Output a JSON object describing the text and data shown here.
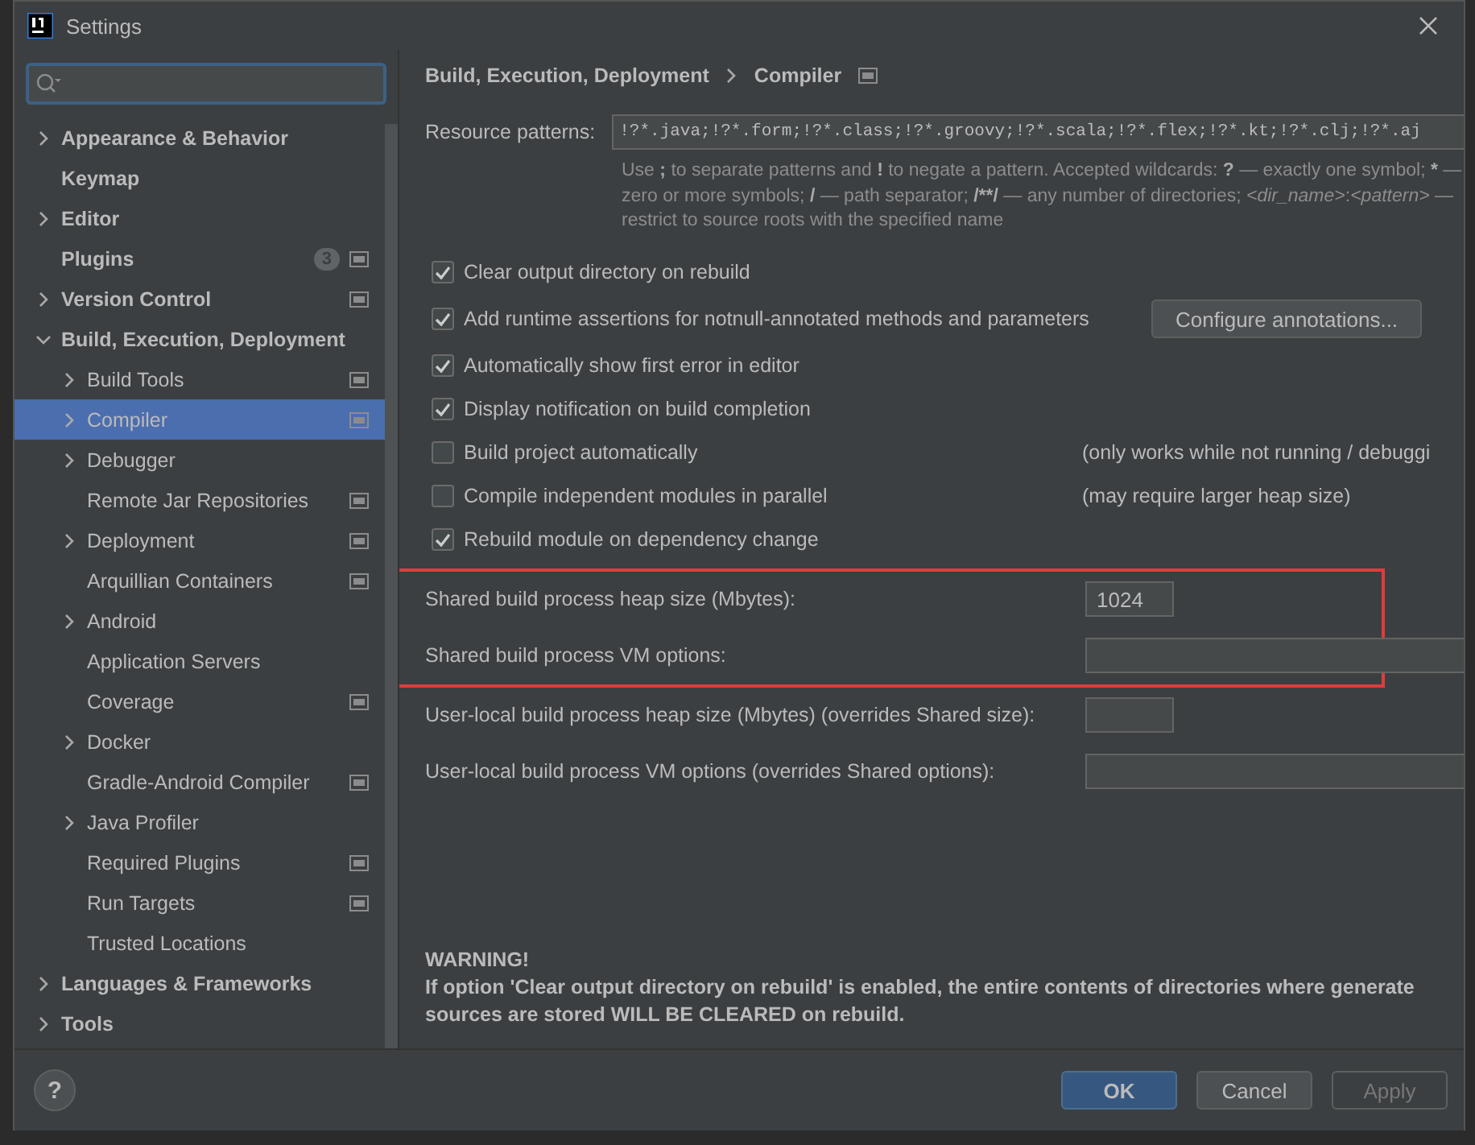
{
  "window": {
    "title": "Settings"
  },
  "sidebar": {
    "items": [
      {
        "label": "Appearance & Behavior",
        "expanded": false,
        "selected": false,
        "project_scope": false
      },
      {
        "label": "Keymap",
        "selected": false,
        "project_scope": false
      },
      {
        "label": "Editor",
        "expanded": false,
        "selected": false,
        "project_scope": false
      },
      {
        "label": "Plugins",
        "selected": false,
        "project_scope": true,
        "badge": "3"
      },
      {
        "label": "Version Control",
        "expanded": false,
        "selected": false,
        "project_scope": true
      },
      {
        "label": "Build, Execution, Deployment",
        "expanded": true,
        "selected": false,
        "project_scope": false,
        "children": [
          {
            "label": "Build Tools",
            "expanded": false,
            "selected": false,
            "project_scope": true
          },
          {
            "label": "Compiler",
            "expanded": false,
            "selected": true,
            "project_scope": true
          },
          {
            "label": "Debugger",
            "expanded": false,
            "selected": false,
            "project_scope": false
          },
          {
            "label": "Remote Jar Repositories",
            "selected": false,
            "project_scope": true
          },
          {
            "label": "Deployment",
            "expanded": false,
            "selected": false,
            "project_scope": true
          },
          {
            "label": "Arquillian Containers",
            "selected": false,
            "project_scope": true
          },
          {
            "label": "Android",
            "expanded": false,
            "selected": false,
            "project_scope": false
          },
          {
            "label": "Application Servers",
            "selected": false,
            "project_scope": false
          },
          {
            "label": "Coverage",
            "selected": false,
            "project_scope": true
          },
          {
            "label": "Docker",
            "expanded": false,
            "selected": false,
            "project_scope": false
          },
          {
            "label": "Gradle-Android Compiler",
            "selected": false,
            "project_scope": true
          },
          {
            "label": "Java Profiler",
            "expanded": false,
            "selected": false,
            "project_scope": false
          },
          {
            "label": "Required Plugins",
            "selected": false,
            "project_scope": true
          },
          {
            "label": "Run Targets",
            "selected": false,
            "project_scope": true
          },
          {
            "label": "Trusted Locations",
            "selected": false,
            "project_scope": false
          }
        ]
      },
      {
        "label": "Languages & Frameworks",
        "expanded": false,
        "selected": false,
        "project_scope": false
      },
      {
        "label": "Tools",
        "expanded": false,
        "selected": false,
        "project_scope": false
      }
    ]
  },
  "content": {
    "breadcrumb": [
      "Build, Execution, Deployment",
      "Compiler"
    ],
    "resource_patterns": {
      "label": "Resource patterns:",
      "value": "!?*.java;!?*.form;!?*.class;!?*.groovy;!?*.scala;!?*.flex;!?*.kt;!?*.clj;!?*.aj",
      "hint": [
        {
          "text": "Use ",
          "kind": "plain"
        },
        {
          "text": ";",
          "kind": "bold"
        },
        {
          "text": " to separate patterns and ",
          "kind": "plain"
        },
        {
          "text": "!",
          "kind": "bold"
        },
        {
          "text": " to negate a pattern. Accepted wildcards: ",
          "kind": "plain"
        },
        {
          "text": "?",
          "kind": "bold"
        },
        {
          "text": " — exactly one symbol; ",
          "kind": "plain"
        },
        {
          "text": "*",
          "kind": "bold"
        },
        {
          "text": " — zero or more symbols; ",
          "kind": "plain"
        },
        {
          "text": "/",
          "kind": "bold"
        },
        {
          "text": " — path separator; ",
          "kind": "plain"
        },
        {
          "text": "/**/",
          "kind": "bold"
        },
        {
          "text": " — any number of directories; ",
          "kind": "plain"
        },
        {
          "text": "<dir_name>",
          "kind": "italic"
        },
        {
          "text": ":",
          "kind": "plain"
        },
        {
          "text": "<pattern>",
          "kind": "italic"
        },
        {
          "text": " — restrict to source roots with the specified name",
          "kind": "plain"
        }
      ]
    },
    "options": [
      {
        "label": "Clear output directory on rebuild",
        "checked": true
      },
      {
        "label": "Add runtime assertions for notnull-annotated methods and parameters",
        "checked": true,
        "button": "Configure annotations..."
      },
      {
        "label": "Automatically show first error in editor",
        "checked": true
      },
      {
        "label": "Display notification on build completion",
        "checked": true
      },
      {
        "label": "Build project automatically",
        "checked": false,
        "note": "(only works while not running / debuggi"
      },
      {
        "label": "Compile independent modules in parallel",
        "checked": false,
        "note": "(may require larger heap size)"
      },
      {
        "label": "Rebuild module on dependency change",
        "checked": true
      }
    ],
    "fields": [
      {
        "label": "Shared build process heap size (Mbytes):",
        "value": "1024",
        "kind": "short",
        "highlighted": true
      },
      {
        "label": "Shared build process VM options:",
        "kind": "wide",
        "highlighted": true
      },
      {
        "label": "User-local build process heap size (Mbytes) (overrides Shared size):",
        "kind": "short",
        "highlighted": false
      },
      {
        "label": "User-local build process VM options (overrides Shared options):",
        "kind": "wide",
        "highlighted": false
      }
    ],
    "warning": {
      "title": "WARNING!",
      "lines": [
        "If option 'Clear output directory on rebuild' is enabled, the entire contents of directories where generate",
        "sources are stored WILL BE CLEARED on rebuild."
      ]
    }
  },
  "footer": {
    "help": "?",
    "buttons": [
      {
        "label": "OK",
        "kind": "primary",
        "disabled": false
      },
      {
        "label": "Cancel",
        "kind": "normal",
        "disabled": false
      },
      {
        "label": "Apply",
        "kind": "normal",
        "disabled": true
      }
    ]
  }
}
